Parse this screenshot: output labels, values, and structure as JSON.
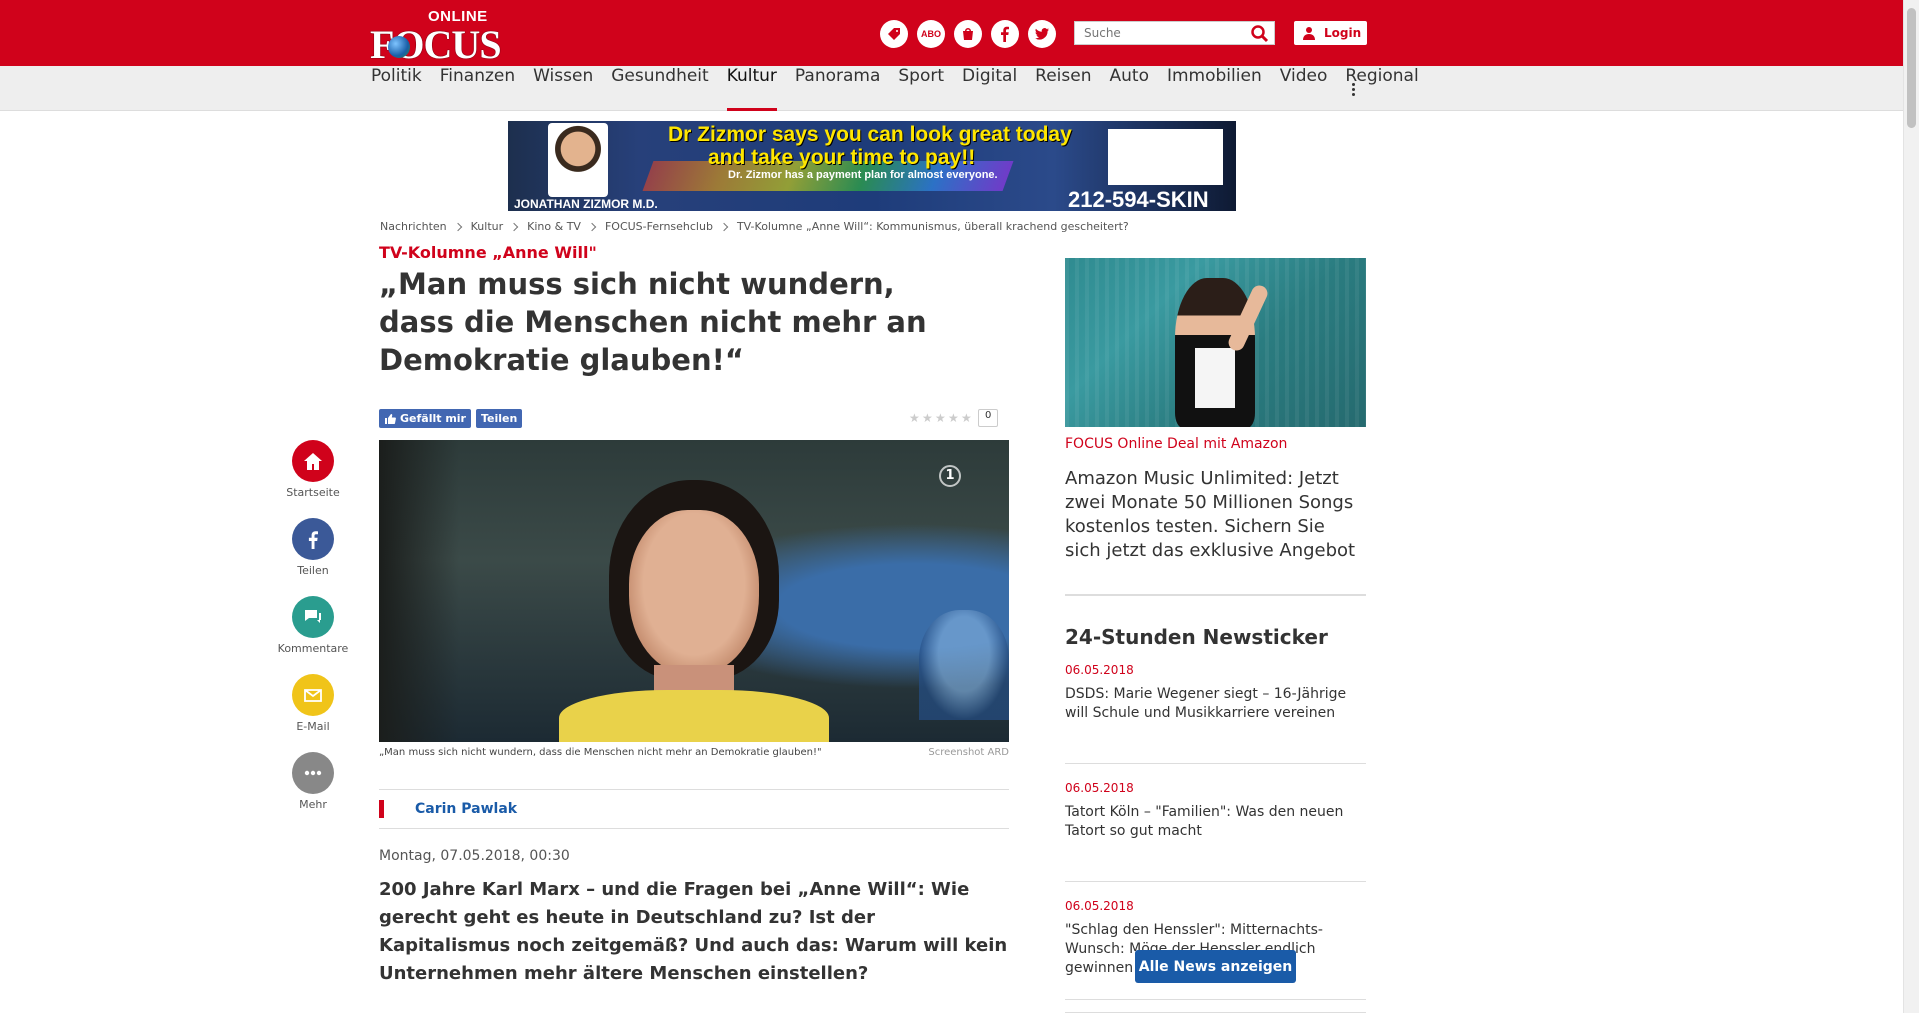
{
  "header": {
    "logo_online": "ONLINE",
    "logo_focus": "FOCUS",
    "icons": [
      "deals-icon",
      "abo-icon",
      "shop-icon",
      "facebook-icon",
      "twitter-icon"
    ],
    "abo_label": "ABO",
    "search_placeholder": "Suche",
    "login_label": "Login",
    "brand_color": "#d0021b"
  },
  "nav": {
    "items": [
      "Politik",
      "Finanzen",
      "Wissen",
      "Gesundheit",
      "Kultur",
      "Panorama",
      "Sport",
      "Digital",
      "Reisen",
      "Auto",
      "Immobilien",
      "Video",
      "Regional"
    ],
    "active": "Kultur"
  },
  "ad": {
    "headline_1": "Dr Zizmor says you can look great today",
    "headline_2": "and take your time to pay!!",
    "sub": "Dr. Zizmor has a payment plan for almost everyone.",
    "name": "JONATHAN ZIZMOR M.D.",
    "phone": "212-594-SKIN"
  },
  "breadcrumb": [
    "Nachrichten",
    "Kultur",
    "Kino & TV",
    "FOCUS-Fernsehclub",
    "TV-Kolumne „Anne Will“: Kommunismus, überall krachend gescheitert?"
  ],
  "rail": [
    {
      "label": "Startseite",
      "color": "#d0021b",
      "icon": "home-icon"
    },
    {
      "label": "Teilen",
      "color": "#3b5998",
      "icon": "facebook-icon"
    },
    {
      "label": "Kommentare",
      "color": "#2a9d8f",
      "icon": "comments-icon"
    },
    {
      "label": "E-Mail",
      "color": "#f0c419",
      "icon": "mail-icon"
    },
    {
      "label": "Mehr",
      "color": "#888888",
      "icon": "more-icon"
    }
  ],
  "article": {
    "kicker": "TV-Kolumne „Anne Will\"",
    "headline": "„Man muss sich nicht wundern, dass die Menschen nicht mehr an Demokratie glauben!“",
    "like_label": "Gefällt mir",
    "share_label": "Teilen",
    "rating_count": "0",
    "caption": "„Man muss sich nicht wundern, dass die Menschen nicht mehr an Demokratie glauben!\"",
    "credit": "Screenshot ARD",
    "author": "Carin Pawlak",
    "date": "Montag, 07.05.2018, 00:30",
    "lead": "200 Jahre Karl Marx – und die Fragen bei „Anne Will“: Wie gerecht geht es heute in Deutschland zu? Ist der Kapitalismus noch zeitgemäß? Und auch das: Warum will kein Unternehmen mehr ältere Menschen einstellen?"
  },
  "sidebar": {
    "deal_kicker": "FOCUS Online Deal mit Amazon",
    "deal_text": "Amazon Music Unlimited: Jetzt zwei Monate 50 Millionen Songs kostenlos testen. Sichern Sie sich jetzt das exklusive Angebot",
    "newsticker_title": "24-Stunden Newsticker",
    "news": [
      {
        "date": "06.05.2018",
        "text": "DSDS: Marie Wegener siegt – 16-Jährige will Schule und Musikkarriere vereinen"
      },
      {
        "date": "06.05.2018",
        "text": "Tatort Köln – \"Familien\": Was den neuen Tatort so gut macht"
      },
      {
        "date": "06.05.2018",
        "text": "\"Schlag den Henssler\": Mitternachts-Wunsch: Möge der Henssler endlich gewinnen!"
      }
    ],
    "all_news_label": "Alle News anzeigen"
  }
}
